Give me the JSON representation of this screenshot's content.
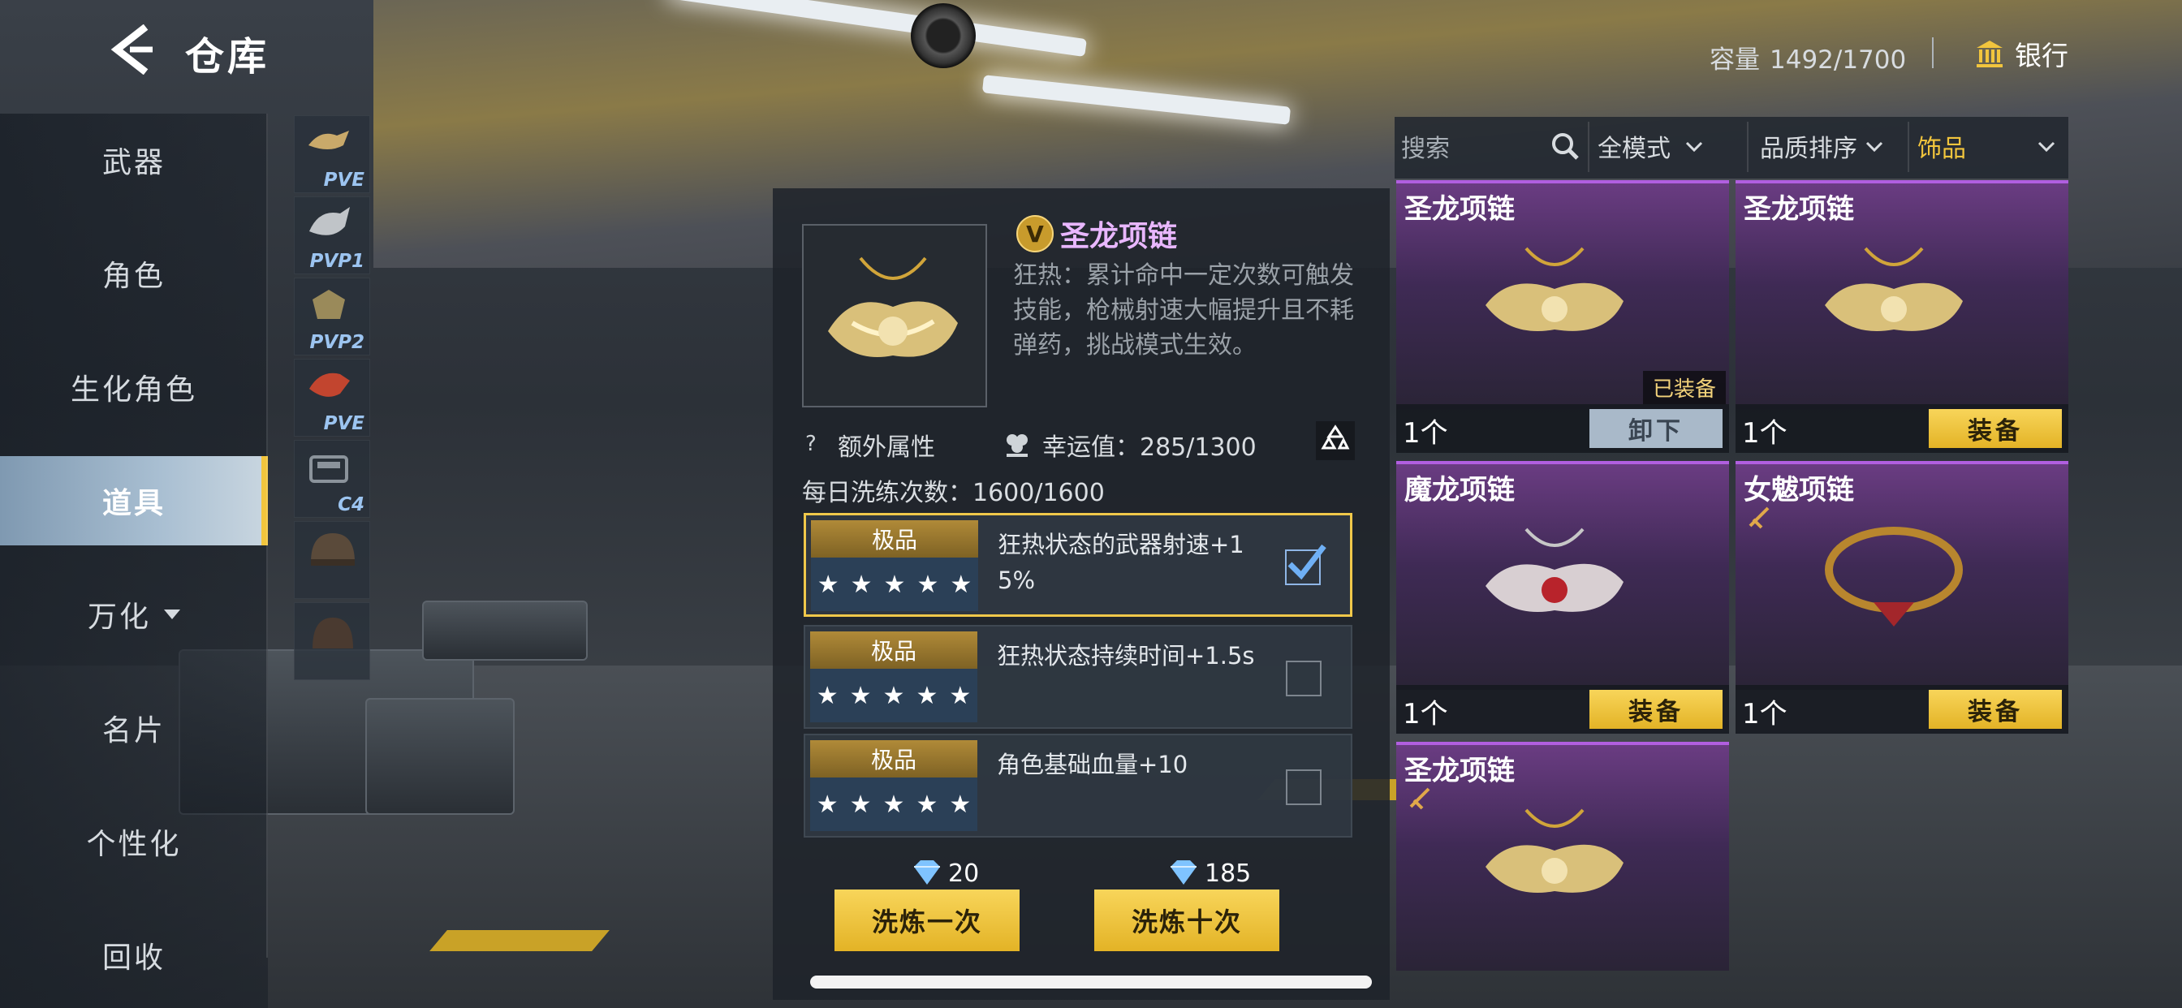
{
  "header": {
    "title": "仓库",
    "capacity_label": "容量",
    "capacity_value": "1492/1700",
    "bank_label": "银行"
  },
  "sidebar": {
    "items": [
      {
        "label": "武器"
      },
      {
        "label": "角色"
      },
      {
        "label": "生化角色"
      },
      {
        "label": "道具"
      },
      {
        "label": "万化"
      },
      {
        "label": "名片"
      },
      {
        "label": "个性化"
      },
      {
        "label": "回收"
      }
    ],
    "active": "道具"
  },
  "subtabs": [
    "PVE",
    "PVP1",
    "PVP2",
    "PVE",
    "C4",
    "",
    ""
  ],
  "detail": {
    "item_name": "圣龙项链",
    "quality_badge": "V",
    "description": "狂热：累计命中一定次数可触发技能，枪械射速大幅提升且不耗弹药，挑战模式生效。",
    "extra_attr_label": "额外属性",
    "luck_label": "幸运值：285/1300",
    "daily_label": "每日洗练次数：1600/1600",
    "attributes": [
      {
        "grade": "极品",
        "stars": 5,
        "text": "狂热状态的武器射速+15%",
        "checked": true
      },
      {
        "grade": "极品",
        "stars": 5,
        "text": "狂热状态持续时间+1.5s",
        "checked": false
      },
      {
        "grade": "极品",
        "stars": 5,
        "text": "角色基础血量+10",
        "checked": false
      }
    ],
    "cost_once": "20",
    "cost_ten": "185",
    "btn_once": "洗炼一次",
    "btn_ten": "洗炼十次"
  },
  "filters": {
    "search_placeholder": "搜索",
    "mode": "全模式",
    "sort": "品质排序",
    "category": "饰品"
  },
  "cards": [
    {
      "name": "圣龙项链",
      "qty": "1个",
      "button": "卸下",
      "equipped_tag": "已装备"
    },
    {
      "name": "圣龙项链",
      "qty": "1个",
      "button": "装备"
    },
    {
      "name": "魔龙项链",
      "qty": "1个",
      "button": "装备"
    },
    {
      "name": "女魃项链",
      "qty": "1个",
      "button": "装备"
    },
    {
      "name": "圣龙项链"
    }
  ],
  "colors": {
    "accent_gold": "#f2c53d",
    "purple_name": "#e9b7ff",
    "card_border": "#b15fe0"
  }
}
